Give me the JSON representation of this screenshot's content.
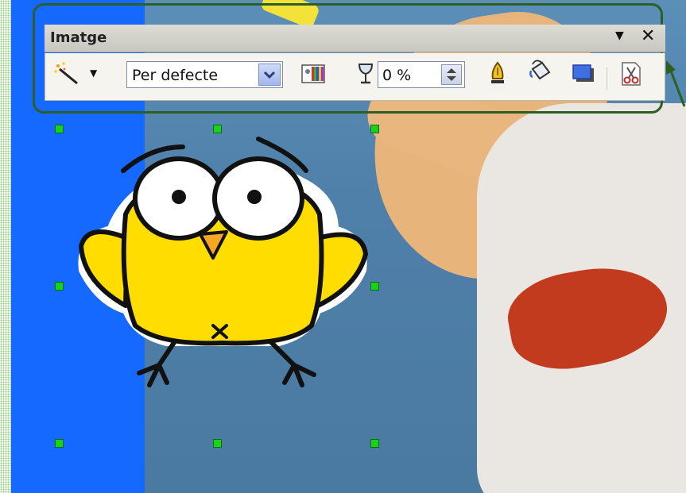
{
  "toolbar": {
    "title": "Imatge",
    "menu_icon": "dropdown-triangle-icon",
    "close_icon": "close-icon",
    "filter_icon": "magic-wand-filter-icon",
    "graphics_mode": "Per defecte",
    "color_icon": "color-adjust-icon",
    "transparency_icon": "transparency-glass-icon",
    "transparency": "0 %",
    "line_icon": "pen-line-icon",
    "area_icon": "paint-bucket-area-icon",
    "shadow_icon": "shadow-icon",
    "crop_icon": "crop-scissors-icon"
  },
  "colors": {
    "border_highlight": "#2e5f22",
    "handle": "#19d21e",
    "canvas_blue": "#1669ff",
    "bird_yellow": "#ffdd00"
  }
}
